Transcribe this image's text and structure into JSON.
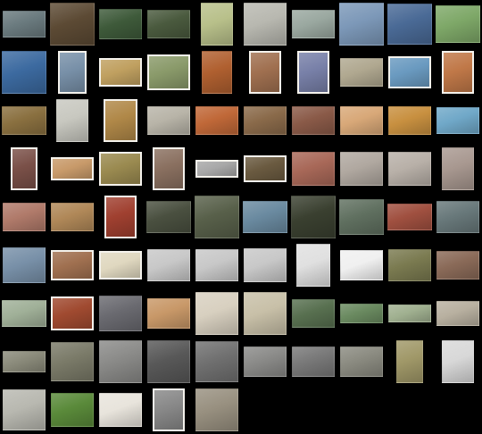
{
  "gallery": {
    "background": "#000000",
    "columns": 10,
    "thumbnails": [
      [
        "#6a7a7e",
        "#5c4a34",
        "#3e5a3a",
        "#4a5a3e",
        "#b8c08a",
        "#b8b8b0",
        "#9aa8a0",
        "#7c98b8",
        "#4a6a96",
        "#7ea868"
      ],
      [
        "#3c6aa0",
        "#7890a8",
        "#c0a060",
        "#8a9a6a",
        "#b06030",
        "#a07050",
        "#7880a8",
        "#b0a890",
        "#6a9ac0",
        "#c07848"
      ],
      [
        "#8a7040",
        "#c8c8c0",
        "#b08848",
        "#b8b4a8",
        "#c06838",
        "#8a6a4a",
        "#8a5a48",
        "#d8a878",
        "#c89040",
        "#70a8c8"
      ],
      [
        "#7a5048",
        "#c89a6a",
        "#9a8a50",
        "#8a7060",
        "#a8a8a8",
        "#6a5a40",
        "#a86858",
        "#b0a8a0",
        "#b8b0a8",
        "#a89890"
      ],
      [
        "#b07a6a",
        "#b08858",
        "#a04030",
        "#4a5040",
        "#58604a",
        "#6a8aa0",
        "#3a4030",
        "#607060",
        "#a05040",
        "#68787a"
      ],
      [
        "#7890a8",
        "#a07050",
        "#e0d8c0",
        "#c8c8c8",
        "#c8c8c8",
        "#c8c8c8",
        "#e0e0e0",
        "#f0f0f0",
        "#7a7a50",
        "#8a6a58"
      ],
      [
        "#a0b098",
        "#a04a30",
        "#6a6a70",
        "#c89868",
        "#d8d0c0",
        "#c8c0a8",
        "#587050",
        "#6a8a60",
        "#a0b090",
        "#b8b0a0"
      ],
      [
        "#8a8a7a",
        "#7a7a68",
        "#8a8a88",
        "#585858",
        "#707070",
        "#8a8a88",
        "#787878",
        "#8a8a80",
        "#a09868",
        "#d8d8d8"
      ],
      [
        "#b8b8b0",
        "#5a8a3a",
        "#e8e4dc",
        "#888888",
        "#989080"
      ]
    ]
  }
}
